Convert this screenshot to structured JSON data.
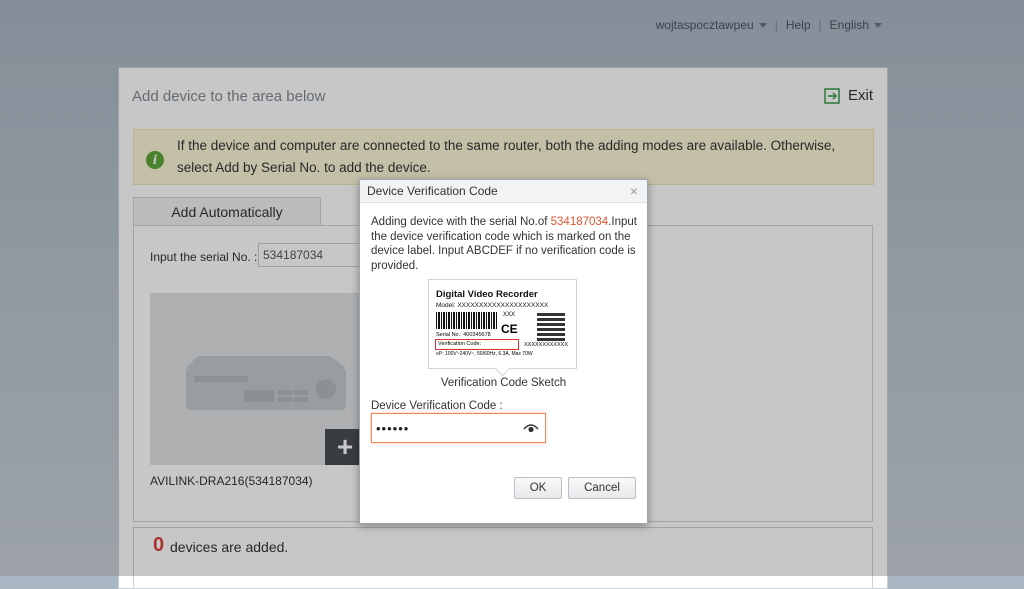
{
  "topbar": {
    "user": "wojtaspocztawpeu",
    "help": "Help",
    "language": "English",
    "separator": "|"
  },
  "panel": {
    "title": "Add device to the area below",
    "exit_label": "Exit",
    "notice": "If the device and computer are connected to the same router, both the adding modes are available. Otherwise, select Add by Serial No. to add the device.",
    "tab_label": "Add Automatically",
    "serial_label": "Input the serial No. :",
    "serial_value": "534187034",
    "device_name": "AVILINK-DRA216(534187034)",
    "added_count": "0",
    "added_text": "devices are added."
  },
  "dialog": {
    "title": "Device Verification Code",
    "close": "×",
    "desc_prefix": "Adding device with the serial No.of ",
    "serial": "534187034",
    "desc_suffix": ".Input the device verification code which is marked on the device label. Input ABCDEF if no verification code is provided.",
    "sketch": {
      "title": "Digital Video Recorder",
      "model": "Model:  XXXXXXXXXXXXXXXXXXXXX",
      "xxx": "XXX",
      "ce": "CE",
      "serial": "Serial No.:  400345678",
      "verification": "Verification Code:",
      "x_code": "XXXXXXXXXXXX",
      "power": "≡P: 100V~240V~, 50/60Hz, 6.3A, Max 70W"
    },
    "sketch_caption": "Verification Code Sketch",
    "field_label": "Device Verification Code :",
    "field_value": "••••••",
    "ok": "OK",
    "cancel": "Cancel"
  },
  "colors": {
    "accent": "#e0562d",
    "count": "#d9433a",
    "info": "#5fa83a",
    "focus_border": "#f08a56"
  }
}
